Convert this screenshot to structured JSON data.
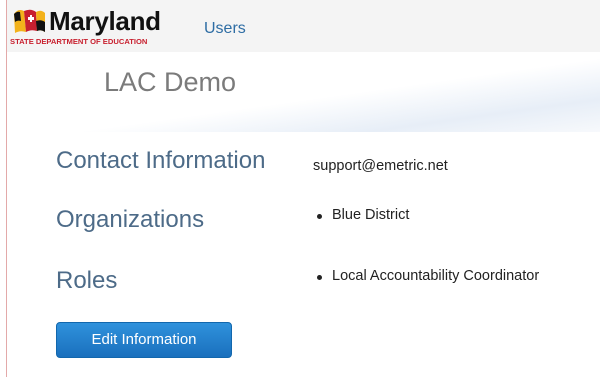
{
  "header": {
    "logo_text": "Maryland",
    "logo_subtext": "STATE DEPARTMENT OF EDUCATION",
    "nav_users": "Users"
  },
  "page": {
    "title": "LAC Demo"
  },
  "profile": {
    "contact": {
      "label": "Contact Information",
      "value": "support@emetric.net"
    },
    "organizations": {
      "label": "Organizations",
      "items": [
        "Blue District"
      ]
    },
    "roles": {
      "label": "Roles",
      "items": [
        "Local Accountability Coordinator"
      ]
    },
    "edit_button_label": "Edit Information"
  },
  "colors": {
    "link": "#2e6da4",
    "section_label": "#4d6b88",
    "button": "#1f7fcf",
    "logo_red": "#c8202f"
  }
}
